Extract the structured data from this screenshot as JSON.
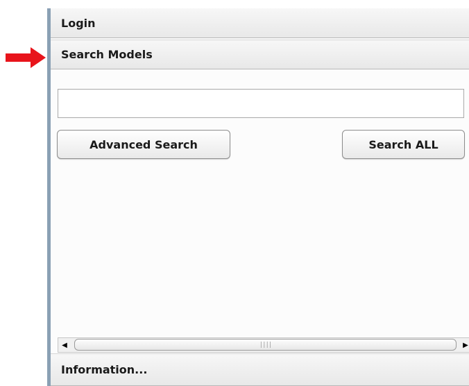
{
  "panel": {
    "login_label": "Login",
    "search_models_label": "Search Models",
    "information_label": "Information..."
  },
  "search": {
    "value": "",
    "placeholder": ""
  },
  "buttons": {
    "advanced_search": "Advanced Search",
    "search_all": "Search ALL"
  },
  "scrollbar": {
    "left_arrow": "◀",
    "right_arrow": "▶",
    "grip": "||||"
  },
  "icons": {
    "pointer": "red-arrow-icon"
  },
  "colors": {
    "arrow": "#e8141b",
    "panel_border": "#8aa0b4"
  }
}
